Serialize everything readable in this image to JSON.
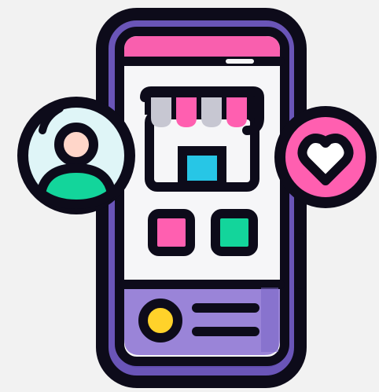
{
  "illustration": {
    "subject": "mobile-shop-app",
    "icons": [
      "user-profile-icon",
      "storefront-icon",
      "heart-icon"
    ]
  },
  "colors": {
    "background": "#f2f2f2",
    "outline": "#0d0b1a",
    "phone_frame": "#6a55b8",
    "phone_frame_shadow": "#4c3da0",
    "screen": "#f6f6f8",
    "top_bar": "#f95fae",
    "bottom_panel": "#9a84d8",
    "bottom_panel_shadow": "#7a66c6",
    "awning_pink": "#ff5fb0",
    "awning_gray": "#c7c7d2",
    "shop_door": "#27c6e6",
    "app_tile_pink": "#ff5fb0",
    "app_tile_green": "#13d59b",
    "avatar_bg": "#dff5f7",
    "avatar_face": "#ffd6c9",
    "avatar_body": "#13d59b",
    "heart_badge": "#ff5fb0",
    "heart_fill": "#ffffff",
    "dot": "#ffd22a"
  }
}
